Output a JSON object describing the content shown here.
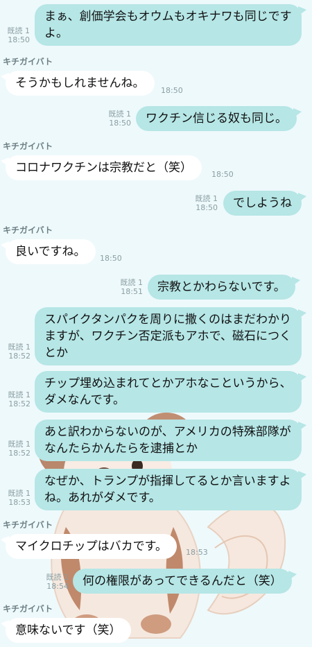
{
  "contact_name": "キチガイバト",
  "read_label": "既読 1",
  "messages": [
    {
      "dir": "out",
      "text": "まぁ、創価学会もオウムもオキナワも同じですよ。",
      "time": "18:50",
      "read": true
    },
    {
      "dir": "in",
      "text": "そうかもしれませんね。",
      "time": "18:50"
    },
    {
      "dir": "out",
      "text": "ワクチン信じる奴も同じ。",
      "time": "18:50",
      "read": true
    },
    {
      "dir": "in",
      "text": "コロナワクチンは宗教だと（笑）",
      "time": "18:50"
    },
    {
      "dir": "out",
      "text": "でしようね",
      "time": "18:50",
      "read": true
    },
    {
      "dir": "in",
      "text": "良いですね。",
      "time": "18:50"
    },
    {
      "dir": "out",
      "text": "宗教とかわらないです。",
      "time": "18:51",
      "read": true
    },
    {
      "dir": "out",
      "text": "スパイクタンパクを周りに撒くのはまだわかりますが、ワクチン否定派もアホで、磁石につくとか",
      "time": "18:52",
      "read": true
    },
    {
      "dir": "out",
      "text": "チップ埋め込まれてとかアホなこというから、ダメなんです。",
      "time": "18:52",
      "read": true
    },
    {
      "dir": "out",
      "text": "あと訳わからないのが、アメリカの特殊部隊がなんたらかんたらを逮捕とか",
      "time": "18:52",
      "read": true
    },
    {
      "dir": "out",
      "text": "なぜか、トランプが指揮してるとか言いますよね。あれがダメです。",
      "time": "18:53",
      "read": true
    },
    {
      "dir": "in",
      "text": "マイクロチップはバカです。",
      "time": "18:53"
    },
    {
      "dir": "out",
      "text": "何の権限があってできるんだと（笑）",
      "time": "18:54",
      "read": true
    },
    {
      "dir": "in",
      "text": "意味ないです（笑）",
      "time": ""
    }
  ]
}
